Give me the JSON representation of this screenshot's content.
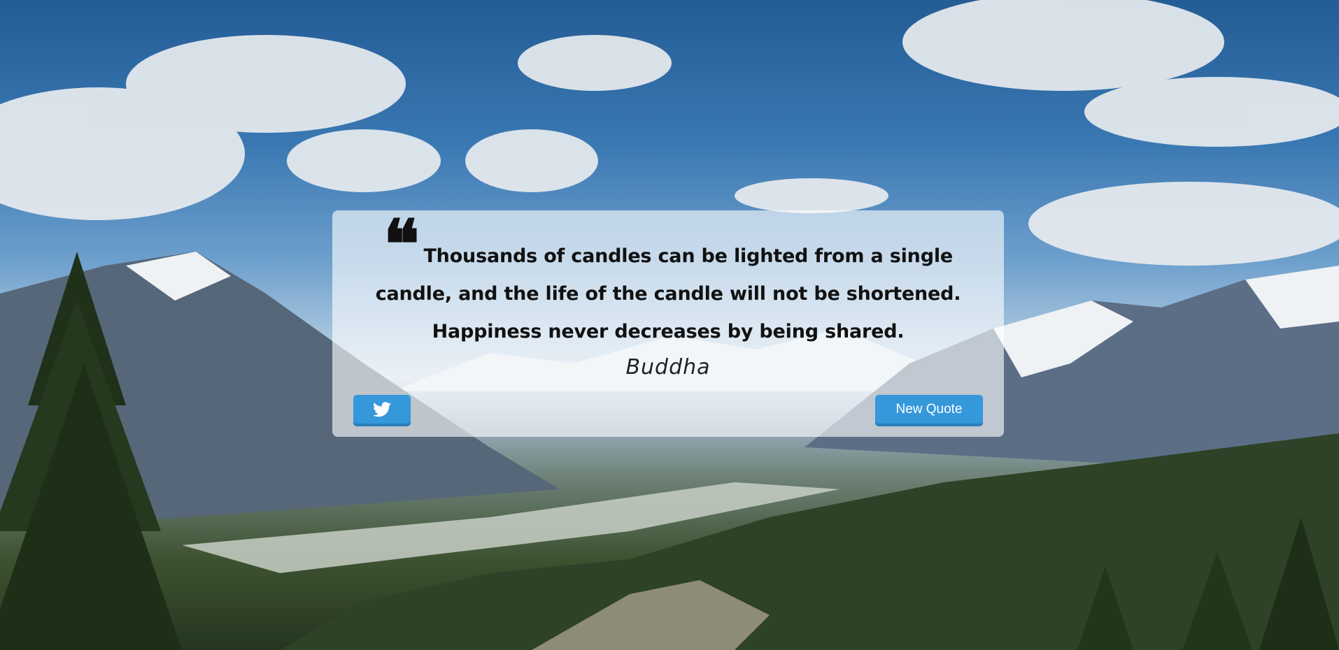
{
  "quote": {
    "mark": "❝",
    "text": "Thousands of candles can be lighted from a single candle, and the life of the candle will not be shortened. Happiness never decreases by being shared.",
    "author": "Buddha"
  },
  "buttons": {
    "tweet_icon": "twitter-icon",
    "new_quote_label": "New Quote"
  },
  "colors": {
    "button": "#3498db",
    "card": "rgba(255,255,255,0.62)"
  }
}
